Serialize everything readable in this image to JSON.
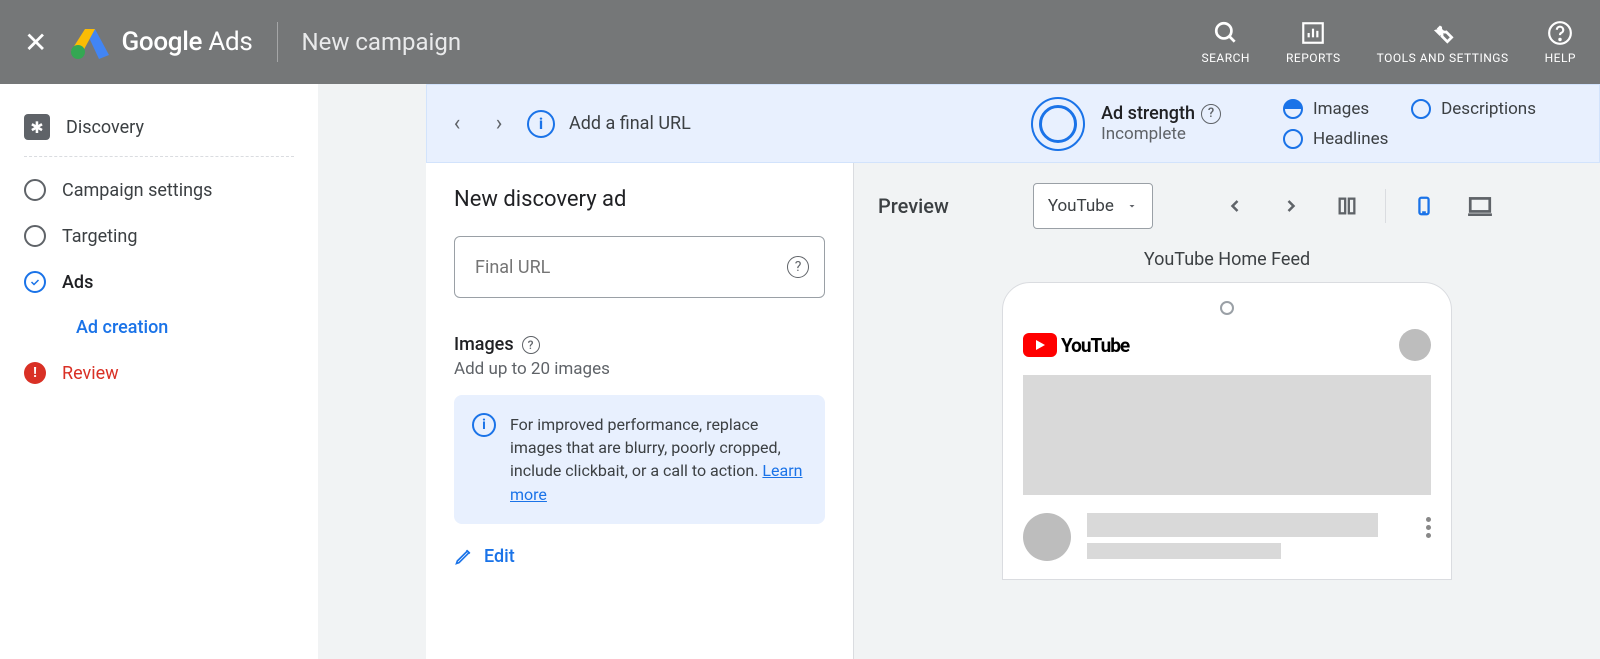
{
  "header": {
    "brand_part1": "Google",
    "brand_part2": "Ads",
    "title": "New campaign"
  },
  "tools": {
    "search": "SEARCH",
    "reports": "REPORTS",
    "settings": "TOOLS AND SETTINGS",
    "help": "HELP"
  },
  "sidebar": {
    "discovery": "Discovery",
    "campaign_settings": "Campaign settings",
    "targeting": "Targeting",
    "ads": "Ads",
    "ad_creation": "Ad creation",
    "review": "Review"
  },
  "topstrip": {
    "hint": "Add a final URL",
    "strength_lbl": "Ad strength",
    "strength_val": "Incomplete",
    "chips": {
      "images": "Images",
      "descriptions": "Descriptions",
      "headlines": "Headlines"
    }
  },
  "form": {
    "title": "New discovery ad",
    "final_url_placeholder": "Final URL",
    "images_head": "Images",
    "images_sub": "Add up to 20 images",
    "info_text": "For improved performance, replace images that are blurry, poorly cropped, include clickbait, or a call to action.",
    "learn_more": "Learn more",
    "edit": "Edit"
  },
  "preview": {
    "title": "Preview",
    "dropdown": "YouTube",
    "feed_title": "YouTube Home Feed",
    "yt_logo_text": "YouTube"
  }
}
